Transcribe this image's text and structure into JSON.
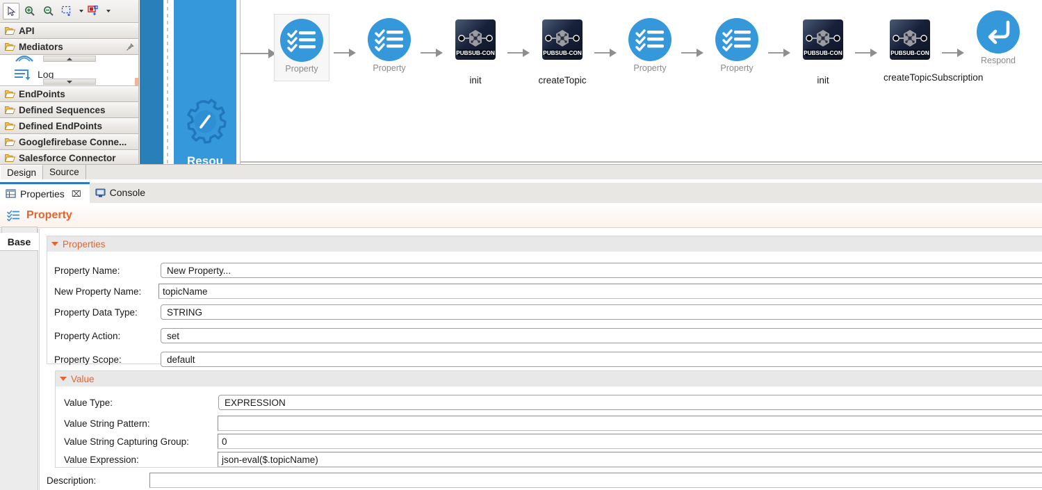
{
  "palette": {
    "toolbar": {
      "tools": [
        {
          "name": "select-tool",
          "icon": "cursor-arrow-icon",
          "active": true
        },
        {
          "name": "zoom-in-tool",
          "icon": "zoom-in-icon",
          "active": false
        },
        {
          "name": "zoom-out-tool",
          "icon": "zoom-out-icon",
          "active": false
        },
        {
          "name": "marquee-tool",
          "icon": "marquee-select-icon",
          "active": false
        },
        {
          "name": "marquee-connection-tool",
          "icon": "marquee-connection-icon",
          "active": false
        }
      ]
    },
    "categories": [
      {
        "label": "API",
        "icon": "folder-open-icon",
        "expanded": false
      },
      {
        "label": "Mediators",
        "icon": "folder-open-icon",
        "expanded": true,
        "pin_icon": "pin-icon"
      },
      {
        "label": "EndPoints",
        "icon": "folder-open-icon",
        "expanded": false
      },
      {
        "label": "Defined Sequences",
        "icon": "folder-open-icon",
        "expanded": false
      },
      {
        "label": "Defined EndPoints",
        "icon": "folder-open-icon",
        "expanded": false
      },
      {
        "label": "Googlefirebase Conne...",
        "icon": "folder-open-icon",
        "expanded": false
      },
      {
        "label": "Salesforce Connector",
        "icon": "folder-open-icon",
        "expanded": false
      }
    ],
    "mediators_items": [
      {
        "label": "Log",
        "icon": "log-mediator-icon"
      }
    ]
  },
  "api_resource": {
    "label": "Resou",
    "icon": "gear-icon",
    "bar_color": "#3498db",
    "dark_bar_color": "#2980b9"
  },
  "diagram": {
    "nodes": [
      {
        "id": "property-1",
        "icon": "property-mediator-icon",
        "inner_label": "Property",
        "ext_label": "",
        "selected": true
      },
      {
        "id": "property-2",
        "icon": "property-mediator-icon",
        "inner_label": "Property",
        "ext_label": "",
        "selected": false
      },
      {
        "id": "init-1",
        "icon": "pubsub-connector-icon",
        "inner_label": "PUBSUB-CON",
        "ext_label": "init",
        "selected": false
      },
      {
        "id": "createtopic",
        "icon": "pubsub-connector-icon",
        "inner_label": "PUBSUB-CON",
        "ext_label": "createTopic",
        "selected": false
      },
      {
        "id": "property-3",
        "icon": "property-mediator-icon",
        "inner_label": "Property",
        "ext_label": "",
        "selected": false
      },
      {
        "id": "property-4",
        "icon": "property-mediator-icon",
        "inner_label": "Property",
        "ext_label": "",
        "selected": false
      },
      {
        "id": "init-2",
        "icon": "pubsub-connector-icon",
        "inner_label": "PUBSUB-CON",
        "ext_label": "init",
        "selected": false
      },
      {
        "id": "createtopicsubscription",
        "icon": "pubsub-connector-icon",
        "inner_label": "PUBSUB-CON",
        "ext_label": "createTopicSubscription",
        "selected": false
      },
      {
        "id": "respond",
        "icon": "respond-mediator-icon",
        "inner_label": "Respond",
        "ext_label": "",
        "selected": false
      }
    ]
  },
  "editor_tabs": [
    {
      "label": "Design",
      "active": true
    },
    {
      "label": "Source",
      "active": false
    }
  ],
  "view_tabs": [
    {
      "label": "Properties",
      "icon": "properties-table-icon",
      "active": true,
      "closable": true,
      "close_glyph": "⌧"
    },
    {
      "label": "Console",
      "icon": "console-monitor-icon",
      "active": false,
      "closable": false
    }
  ],
  "properties_view": {
    "title": "Property",
    "title_icon": "property-mediator-small-icon",
    "title_color": "#e8622a",
    "side_tabs": [
      {
        "label": "Base",
        "active": true
      }
    ],
    "sections": [
      {
        "label": "Properties",
        "expanded": true,
        "fields": [
          {
            "label": "Property Name:",
            "value": "New Property...",
            "type": "combo"
          },
          {
            "label": "New Property Name:",
            "value": "topicName",
            "type": "text"
          },
          {
            "label": "Property Data Type:",
            "value": "STRING",
            "type": "combo"
          },
          {
            "label": "Property Action:",
            "value": "set",
            "type": "combo"
          },
          {
            "label": "Property Scope:",
            "value": "default",
            "type": "combo"
          }
        ]
      },
      {
        "label": "Value",
        "expanded": true,
        "fields": [
          {
            "label": "Value Type:",
            "value": "EXPRESSION",
            "type": "combo"
          },
          {
            "label": "Value String Pattern:",
            "value": "",
            "type": "text"
          },
          {
            "label": "Value String Capturing Group:",
            "value": "0",
            "type": "text"
          },
          {
            "label": "Value Expression:",
            "value": "json-eval($.topicName)",
            "type": "text"
          }
        ]
      }
    ],
    "footer_fields": [
      {
        "label": "Description:",
        "value": "",
        "type": "text"
      }
    ]
  }
}
